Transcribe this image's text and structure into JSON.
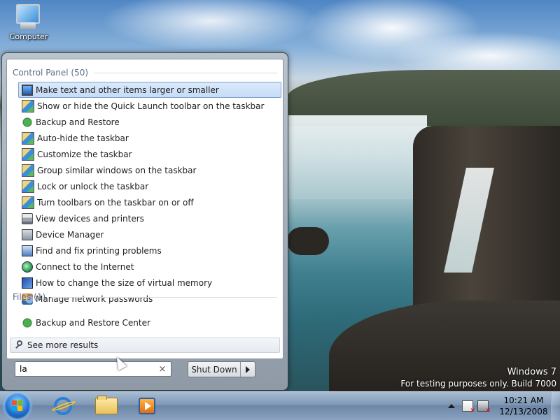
{
  "desktop": {
    "icons": [
      {
        "label": "Computer",
        "icon": "computer-icon"
      }
    ],
    "watermark": {
      "line1": "Windows 7",
      "line2": "For testing purposes only. Build 7000"
    }
  },
  "start_menu": {
    "groups": [
      {
        "header": "Control Panel (50)",
        "items": [
          {
            "label": "Make text and other items larger or smaller",
            "icon": "display-icon",
            "selected": true
          },
          {
            "label": "Show or hide the Quick Launch toolbar on the taskbar",
            "icon": "taskbar-settings-icon"
          },
          {
            "label": "Backup and Restore",
            "icon": "backup-icon"
          },
          {
            "label": "Auto-hide the taskbar",
            "icon": "taskbar-settings-icon"
          },
          {
            "label": "Customize the taskbar",
            "icon": "taskbar-settings-icon"
          },
          {
            "label": "Group similar windows on the taskbar",
            "icon": "taskbar-settings-icon"
          },
          {
            "label": "Lock or unlock the taskbar",
            "icon": "taskbar-settings-icon"
          },
          {
            "label": "Turn toolbars on the taskbar on or off",
            "icon": "taskbar-settings-icon"
          },
          {
            "label": "View devices and printers",
            "icon": "printer-icon"
          },
          {
            "label": "Device Manager",
            "icon": "device-manager-icon"
          },
          {
            "label": "Find and fix printing problems",
            "icon": "troubleshoot-icon"
          },
          {
            "label": "Connect to the Internet",
            "icon": "globe-icon"
          },
          {
            "label": "How to change the size of virtual memory",
            "icon": "help-icon"
          },
          {
            "label": "Manage network passwords",
            "icon": "users-icon"
          }
        ]
      },
      {
        "header": "Files (1)",
        "items": [
          {
            "label": "Backup and Restore Center",
            "icon": "backup-icon"
          }
        ]
      }
    ],
    "see_more": "See more results",
    "search": {
      "value": "la",
      "clear": "×"
    },
    "shutdown_label": "Shut Down"
  },
  "taskbar": {
    "pinned": [
      "internet-explorer-icon",
      "windows-explorer-icon",
      "media-player-icon"
    ],
    "clock": {
      "time": "10:21 AM",
      "date": "12/13/2008"
    }
  }
}
